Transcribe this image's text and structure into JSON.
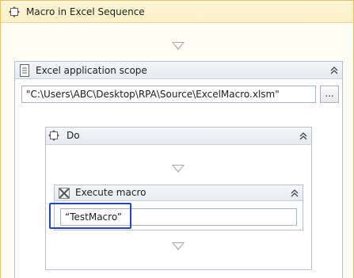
{
  "sequence": {
    "title": "Macro in Excel Sequence"
  },
  "excel_scope": {
    "title": "Excel application scope",
    "workbook_path": "\"C:\\Users\\ABC\\Desktop\\RPA\\Source\\ExcelMacro.xlsm\"",
    "browse_label": "..."
  },
  "do_block": {
    "title": "Do"
  },
  "execute_macro": {
    "title": "Execute macro",
    "macro_name": "“TestMacro”"
  },
  "colors": {
    "sequence_border": "#e8c266",
    "highlight": "#2244cc"
  }
}
